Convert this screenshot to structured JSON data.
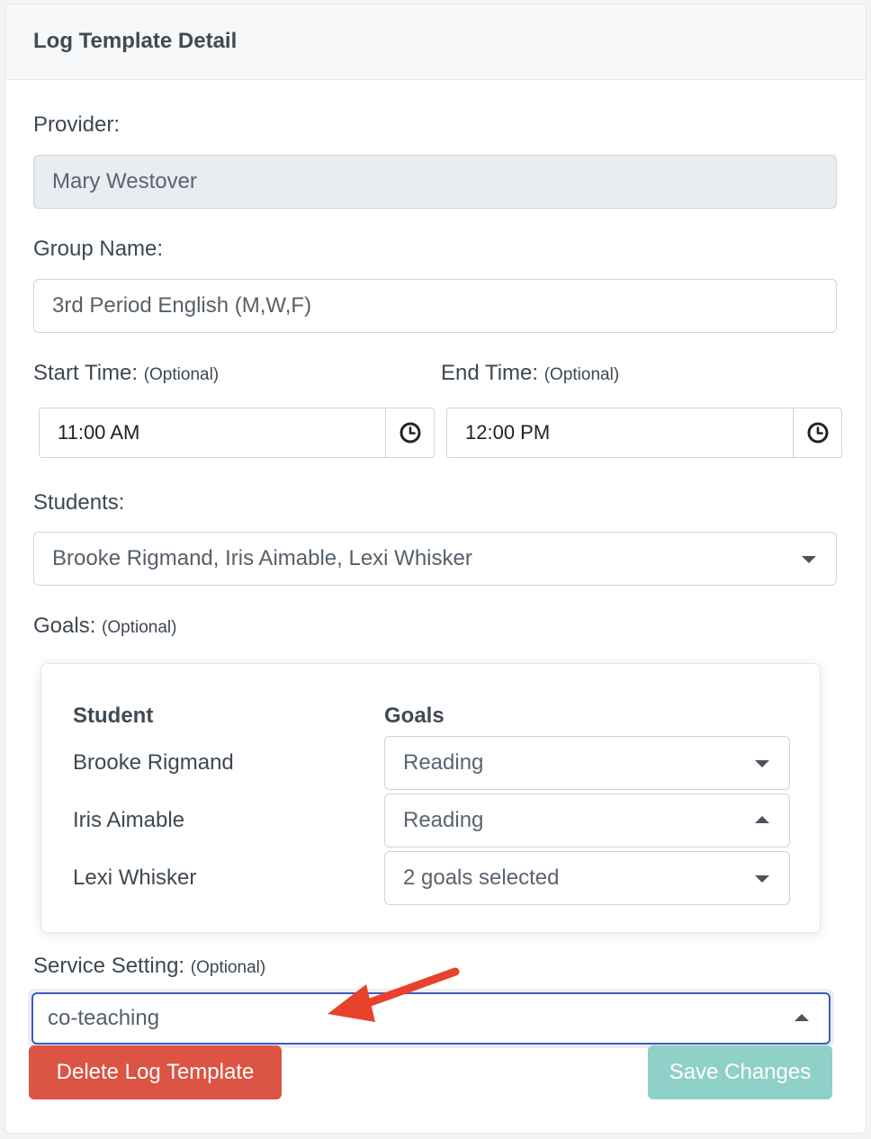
{
  "card": {
    "title": "Log Template Detail"
  },
  "provider": {
    "label": "Provider:",
    "value": "Mary Westover"
  },
  "group_name": {
    "label": "Group Name:",
    "value": "3rd Period English (M,W,F)"
  },
  "start_time": {
    "label": "Start Time:",
    "optional": "(Optional)",
    "value": "11:00 AM",
    "icon": "clock-icon"
  },
  "end_time": {
    "label": "End Time:",
    "optional": "(Optional)",
    "value": "12:00 PM",
    "icon": "clock-icon"
  },
  "students": {
    "label": "Students:",
    "value": "Brooke Rigmand, Iris Aimable, Lexi Whisker"
  },
  "goals": {
    "label": "Goals:",
    "optional": "(Optional)",
    "header_student": "Student",
    "header_goals": "Goals",
    "rows": [
      {
        "student": "Brooke Rigmand",
        "goal": "Reading",
        "state": "collapsed"
      },
      {
        "student": "Iris Aimable",
        "goal": "Reading",
        "state": "expanded"
      },
      {
        "student": "Lexi Whisker",
        "goal": "2 goals selected",
        "state": "collapsed"
      }
    ]
  },
  "service_setting": {
    "label": "Service Setting:",
    "optional": "(Optional)",
    "value": "co-teaching"
  },
  "buttons": {
    "delete": "Delete Log Template",
    "save": "Save Changes"
  },
  "colors": {
    "focus_border": "#3b5bc4",
    "danger": "#dc5443",
    "primary_disabled": "#8fd0c8",
    "annotation_arrow": "#e8412c"
  }
}
